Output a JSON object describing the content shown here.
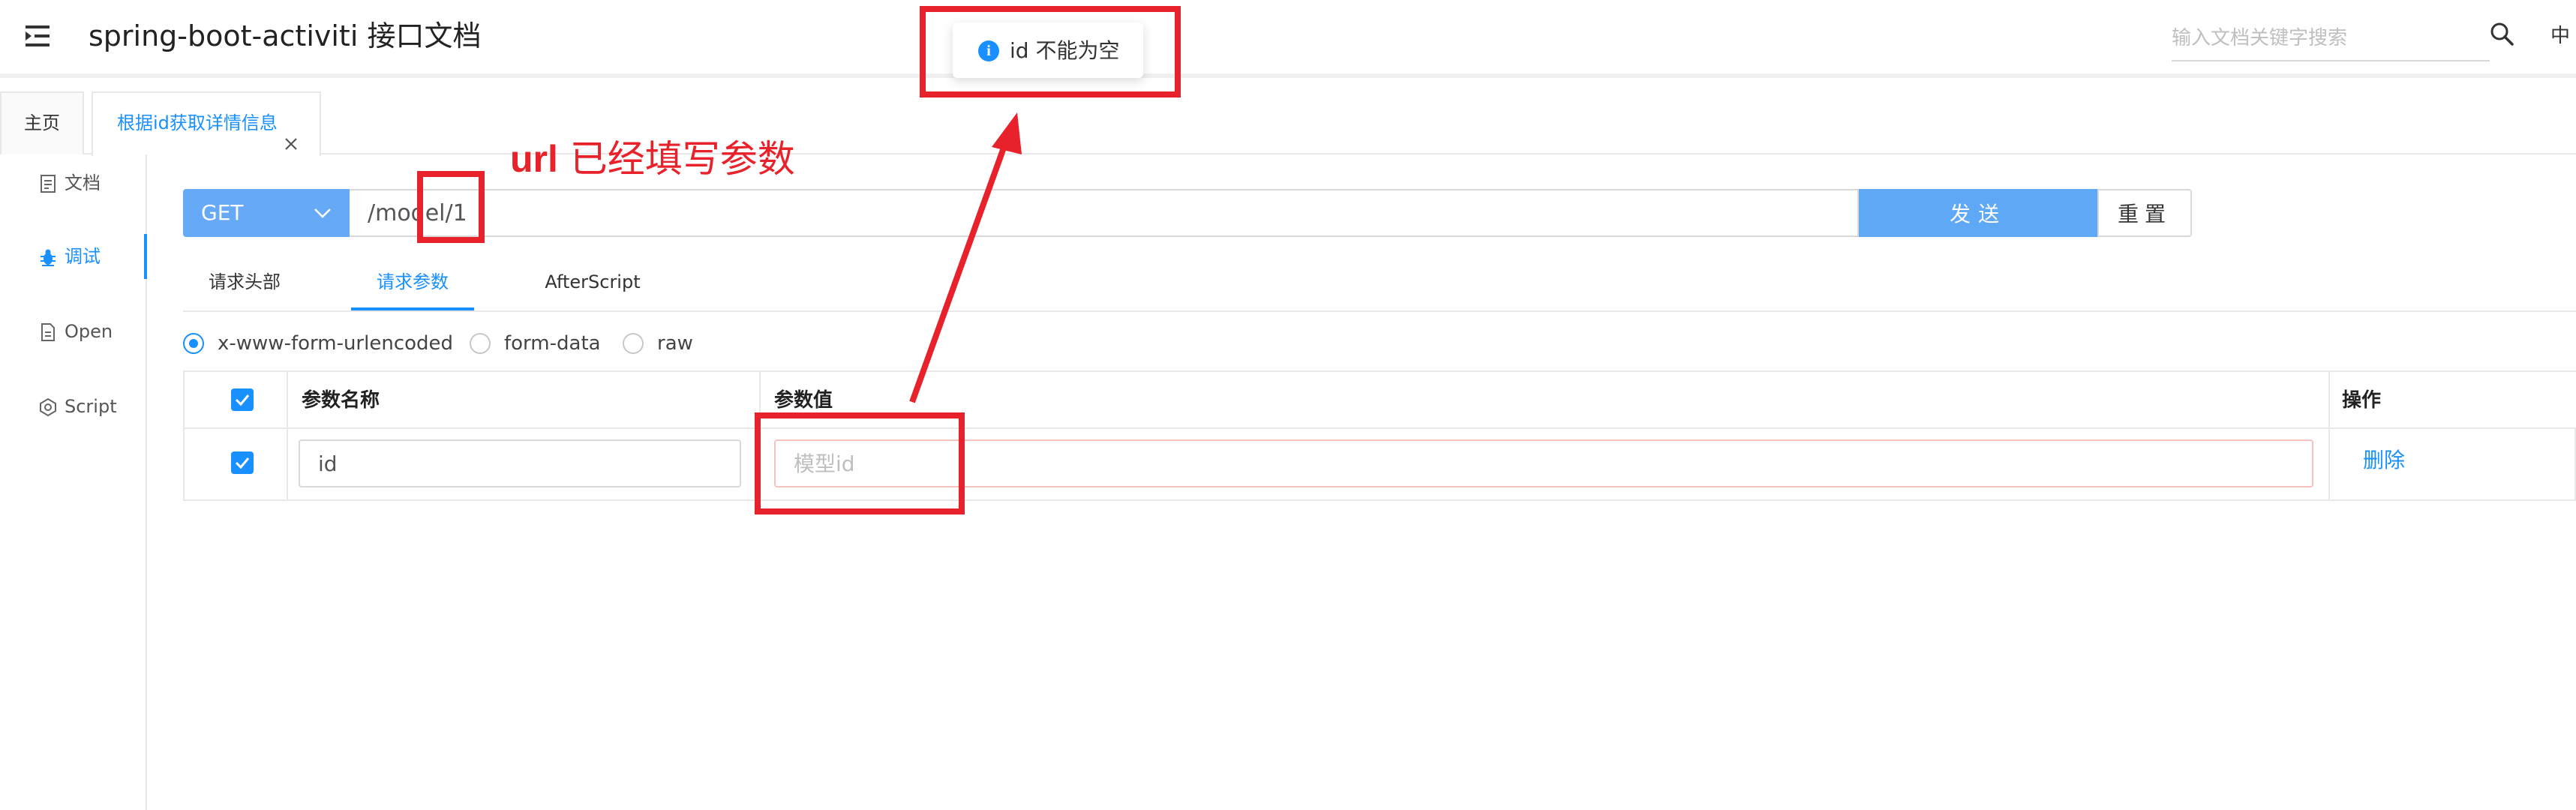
{
  "header": {
    "title": "spring-boot-activiti 接口文档",
    "search_placeholder": "输入文档关键字搜索",
    "lang": "中"
  },
  "toast": {
    "icon": "info-icon",
    "message": "id 不能为空"
  },
  "tabs": [
    {
      "label": "主页"
    },
    {
      "label": "根据id获取详情信息"
    }
  ],
  "sidebar": {
    "items": [
      {
        "label": "文档",
        "icon": "document-icon"
      },
      {
        "label": "调试",
        "icon": "bug-icon",
        "active": true
      },
      {
        "label": "Open",
        "icon": "file-icon"
      },
      {
        "label": "Script",
        "icon": "script-icon"
      }
    ]
  },
  "request": {
    "method": "GET",
    "url": "/model/1",
    "send_label": "发送",
    "reset_label": "重置"
  },
  "param_tabs": [
    {
      "label": "请求头部"
    },
    {
      "label": "请求参数",
      "active": true
    },
    {
      "label": "AfterScript"
    }
  ],
  "body_types": [
    {
      "label": "x-www-form-urlencoded",
      "checked": true
    },
    {
      "label": "form-data"
    },
    {
      "label": "raw"
    }
  ],
  "table": {
    "headers": {
      "name": "参数名称",
      "value": "参数值",
      "action": "操作"
    },
    "rows": [
      {
        "name": "id",
        "value": "",
        "value_placeholder": "模型id",
        "action": "删除"
      }
    ]
  },
  "annotation": {
    "text_bold": "url",
    "text_rest": " 已经填写参数",
    "color": "#e8222b"
  },
  "colors": {
    "accent": "#1890ff",
    "button": "#5fa8f6",
    "annotation": "#e8222b"
  }
}
